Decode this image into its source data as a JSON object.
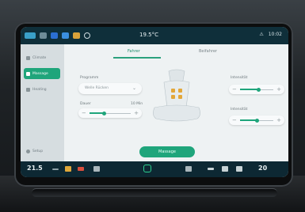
{
  "status_bar": {
    "title": "19.5°C",
    "time": "10:02",
    "icon_colors": [
      "#3aa0c8",
      "#2b6fd1",
      "#3b8fe0",
      "#d9a23a",
      "#c9542e"
    ]
  },
  "sidebar": {
    "items": [
      {
        "label": "Climate",
        "active": false
      },
      {
        "label": "Massage",
        "active": true
      },
      {
        "label": "Heating",
        "active": false
      },
      {
        "label": "Setup",
        "active": false
      }
    ]
  },
  "tabs": [
    {
      "label": "Fahrer",
      "selected": true
    },
    {
      "label": "Beifahrer",
      "selected": false
    }
  ],
  "program": {
    "label": "Programm",
    "value": "Welle Rücken"
  },
  "speed": {
    "label": "Dauer",
    "value_text": "10 Min",
    "level": 0.35
  },
  "intensity_top": {
    "label": "Intensität",
    "level": 0.55
  },
  "intensity_bottom": {
    "label": "Intensität",
    "level": 0.5
  },
  "confirm_button": "Massage",
  "bottom_bar": {
    "temp_left": "21.5",
    "temp_right": "20",
    "accent": "#2dd08f"
  }
}
